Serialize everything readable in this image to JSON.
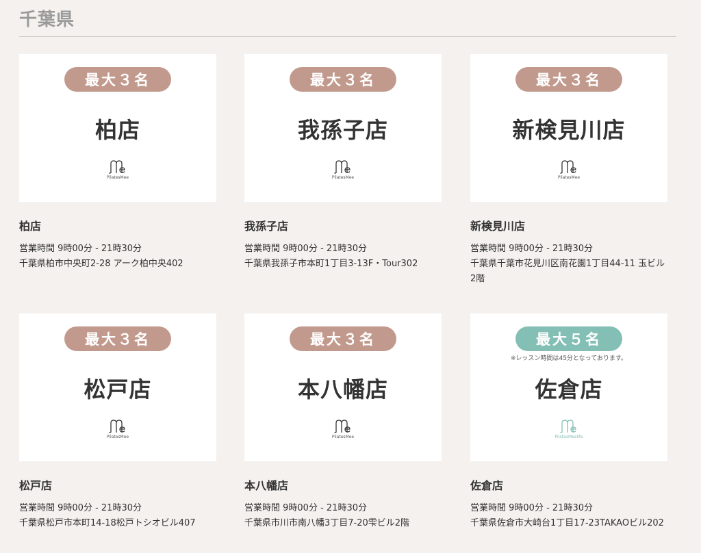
{
  "section": {
    "title": "千葉県"
  },
  "colors": {
    "badge_default": "#c29a8d",
    "badge_life": "#84bfb5"
  },
  "stores": [
    {
      "badge": "最大３名",
      "badge_color": "#c29a8d",
      "note": "",
      "card_title": "柏店",
      "logo_text": "PilatesMee",
      "name": "柏店",
      "hours": "営業時間 9時00分 - 21時30分",
      "address": "千葉県柏市中央町2-28 アーク柏中央402"
    },
    {
      "badge": "最大３名",
      "badge_color": "#c29a8d",
      "note": "",
      "card_title": "我孫子店",
      "logo_text": "PilatesMee",
      "name": "我孫子店",
      "hours": "営業時間 9時00分 - 21時30分",
      "address": "千葉県我孫子市本町1丁目3-13F・Tour302"
    },
    {
      "badge": "最大３名",
      "badge_color": "#c29a8d",
      "note": "",
      "card_title": "新検見川店",
      "logo_text": "PilatesMee",
      "name": "新検見川店",
      "hours": "営業時間 9時00分 - 21時30分",
      "address": "千葉県千葉市花見川区南花園1丁目44-11 玉ビル2階"
    },
    {
      "badge": "最大３名",
      "badge_color": "#c29a8d",
      "note": "",
      "card_title": "松戸店",
      "logo_text": "PilatesMee",
      "name": "松戸店",
      "hours": "営業時間 9時00分 - 21時30分",
      "address": "千葉県松戸市本町14-18松戸トシオビル407"
    },
    {
      "badge": "最大３名",
      "badge_color": "#c29a8d",
      "note": "",
      "card_title": "本八幡店",
      "logo_text": "PilatesMee",
      "name": "本八幡店",
      "hours": "営業時間 9時00分 - 21時30分",
      "address": "千葉県市川市南八幡3丁目7-20雫ビル2階"
    },
    {
      "badge": "最大５名",
      "badge_color": "#84bfb5",
      "note": "※レッスン時間は45分となっております。",
      "card_title": "佐倉店",
      "logo_text": "PilatesMeelife",
      "name": "佐倉店",
      "hours": "営業時間 9時00分 - 21時30分",
      "address": "千葉県佐倉市大崎台1丁目17-23TAKAOビル202"
    }
  ]
}
